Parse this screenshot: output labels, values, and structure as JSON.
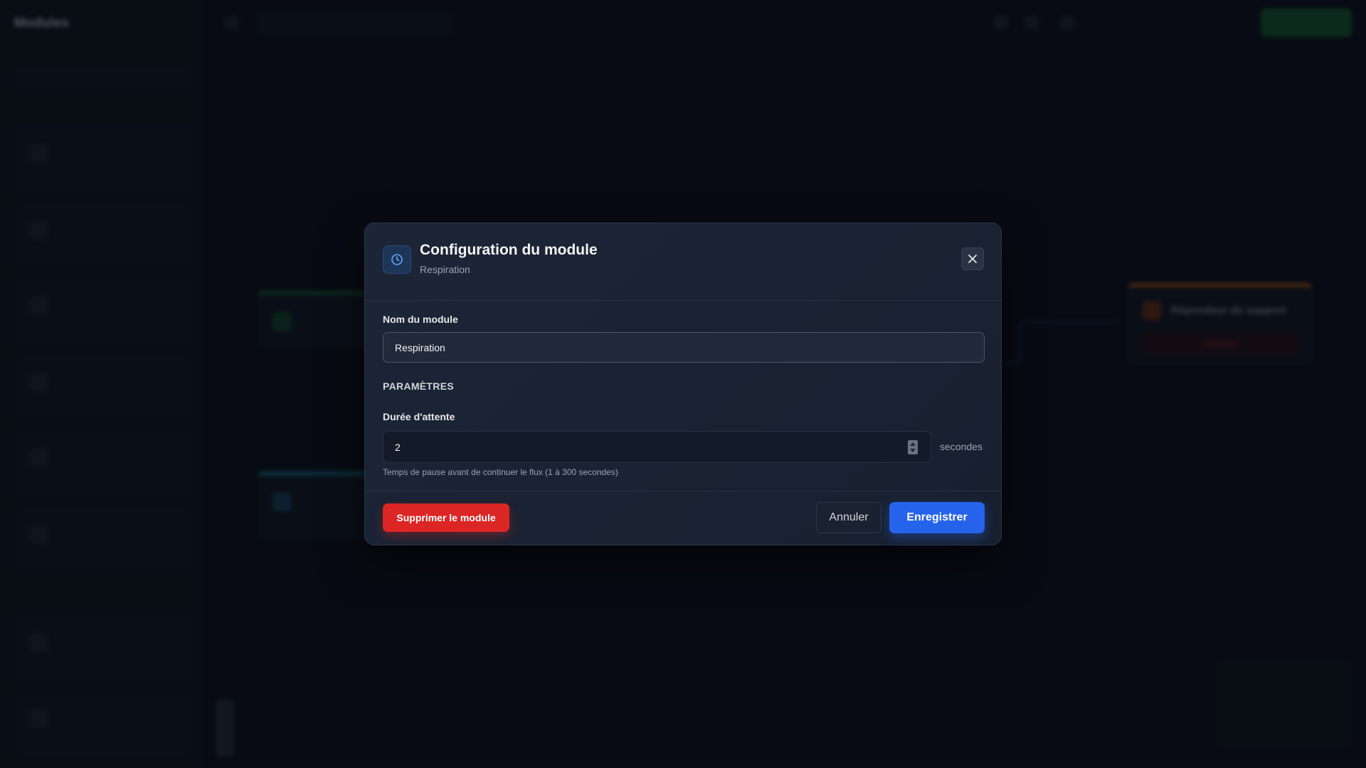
{
  "background": {
    "sidebar": {
      "title": "Modules",
      "subtitle": "",
      "search_placeholder": "",
      "sections": [
        "",
        ""
      ],
      "cards": [
        {
          "title": "",
          "desc": ""
        },
        {
          "title": "",
          "desc": ""
        },
        {
          "title": "",
          "desc": ""
        },
        {
          "title": "",
          "desc": ""
        },
        {
          "title": "",
          "desc": ""
        },
        {
          "title": "",
          "desc": ""
        },
        {
          "title": "",
          "desc": ""
        },
        {
          "title": "",
          "desc": ""
        }
      ]
    },
    "topbar": {
      "flow_name": "",
      "zoom_label": "",
      "debug_label": "",
      "save_label": ""
    },
    "nodes": {
      "top_title": "",
      "bottom_title": "",
      "support_title": "Répondeur du support",
      "support_action": "Terminé"
    }
  },
  "modal": {
    "icon": "clock-icon",
    "title": "Configuration du module",
    "subtitle": "Respiration",
    "close_icon": "close-icon",
    "name_label": "Nom du module",
    "name_value": "Respiration",
    "params_title": "PARAMÈTRES",
    "wait_label": "Durée d'attente",
    "wait_value": "2",
    "wait_unit": "secondes",
    "wait_hint": "Temps de pause avant de continuer le flux (1 à 300 secondes)",
    "delete_label": "Supprimer le module",
    "cancel_label": "Annuler",
    "save_label": "Enregistrer"
  },
  "colors": {
    "accent": "#2563eb",
    "danger": "#dc2626",
    "modal_bg": "#1a2231"
  }
}
